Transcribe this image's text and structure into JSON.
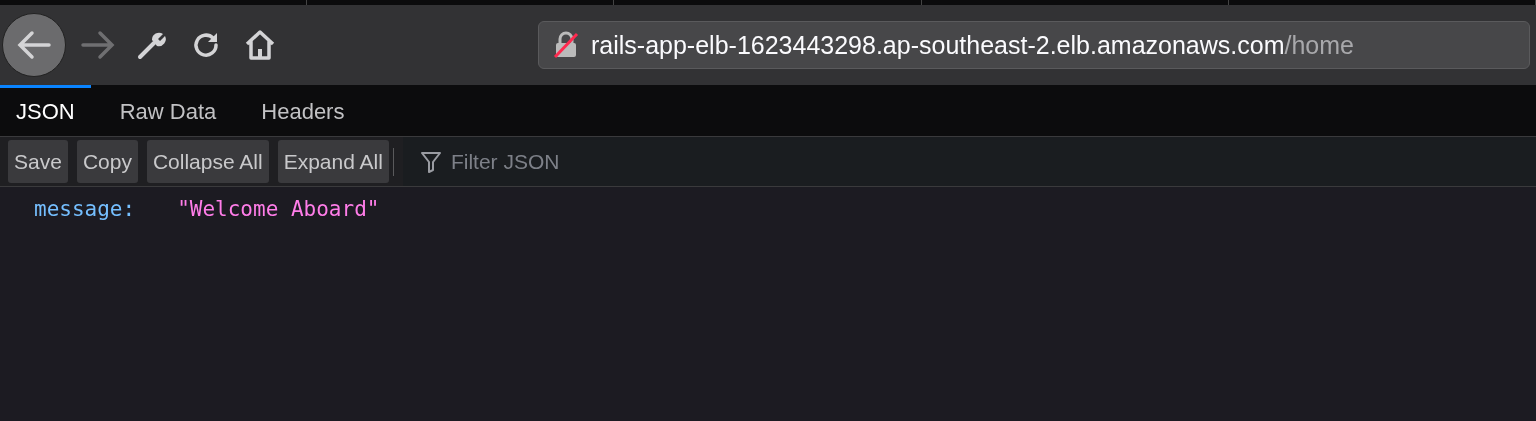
{
  "nav_buttons": [
    {
      "kind": "back",
      "disabled": false
    },
    {
      "kind": "forward",
      "disabled": true
    },
    {
      "kind": "tools",
      "disabled": false
    },
    {
      "kind": "reload",
      "disabled": false
    },
    {
      "kind": "home",
      "disabled": false
    }
  ],
  "address_bar": {
    "host": "rails-app-elb-1623443298.ap-southeast-2.elb.amazonaws.com",
    "path": "/home",
    "insecure": true
  },
  "tabs": [
    {
      "label": "JSON",
      "selected": true
    },
    {
      "label": "Raw Data",
      "selected": false
    },
    {
      "label": "Headers",
      "selected": false
    }
  ],
  "toolbar": {
    "buttons": [
      "Save",
      "Copy",
      "Collapse All",
      "Expand All"
    ],
    "filter": {
      "placeholder": "Filter JSON"
    }
  },
  "json": [
    {
      "key": "message:",
      "value": "\"Welcome Aboard\""
    }
  ]
}
